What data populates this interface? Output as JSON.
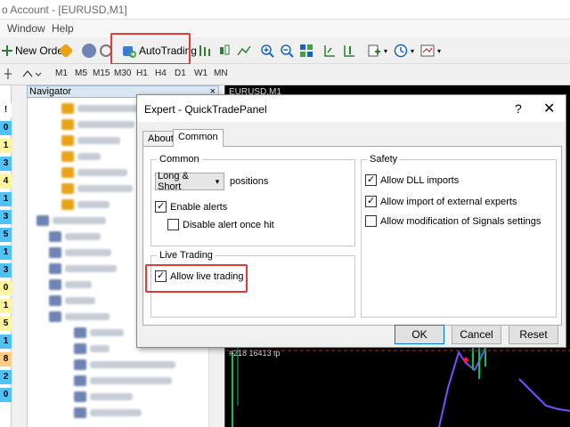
{
  "window": {
    "title": "o Account - [EURUSD,M1]"
  },
  "menu": {
    "window": "Window",
    "help": "Help"
  },
  "toolbar": {
    "new_order": "New Order",
    "autotrading": "AutoTrading"
  },
  "timeframes": [
    "M1",
    "M5",
    "M15",
    "M30",
    "H1",
    "H4",
    "D1",
    "W1",
    "MN"
  ],
  "left_column_values": [
    "!",
    "0",
    "1",
    "3",
    "4",
    "1",
    "3",
    "5",
    "1",
    "3",
    "0",
    "1",
    "5",
    "1",
    "8",
    "2",
    "0"
  ],
  "navigator": {
    "title": "Navigator",
    "close": "×"
  },
  "chart": {
    "title": "EURUSD,M1",
    "price_label": "#218 16413 tp"
  },
  "dialog": {
    "title": "Expert - QuickTradePanel",
    "help": "?",
    "close": "✕",
    "tabs": {
      "about": "About",
      "common": "Common"
    },
    "common_group": {
      "title": "Common",
      "positions_select": "Long & Short",
      "positions_label": "positions",
      "enable_alerts": "Enable alerts",
      "disable_alert": "Disable alert once hit"
    },
    "live_group": {
      "title": "Live Trading",
      "allow_live": "Allow live trading"
    },
    "safety_group": {
      "title": "Safety",
      "allow_dll": "Allow DLL imports",
      "allow_external": "Allow import of external experts",
      "allow_signals": "Allow modification of Signals settings"
    },
    "buttons": {
      "ok": "OK",
      "cancel": "Cancel",
      "reset": "Reset"
    }
  }
}
